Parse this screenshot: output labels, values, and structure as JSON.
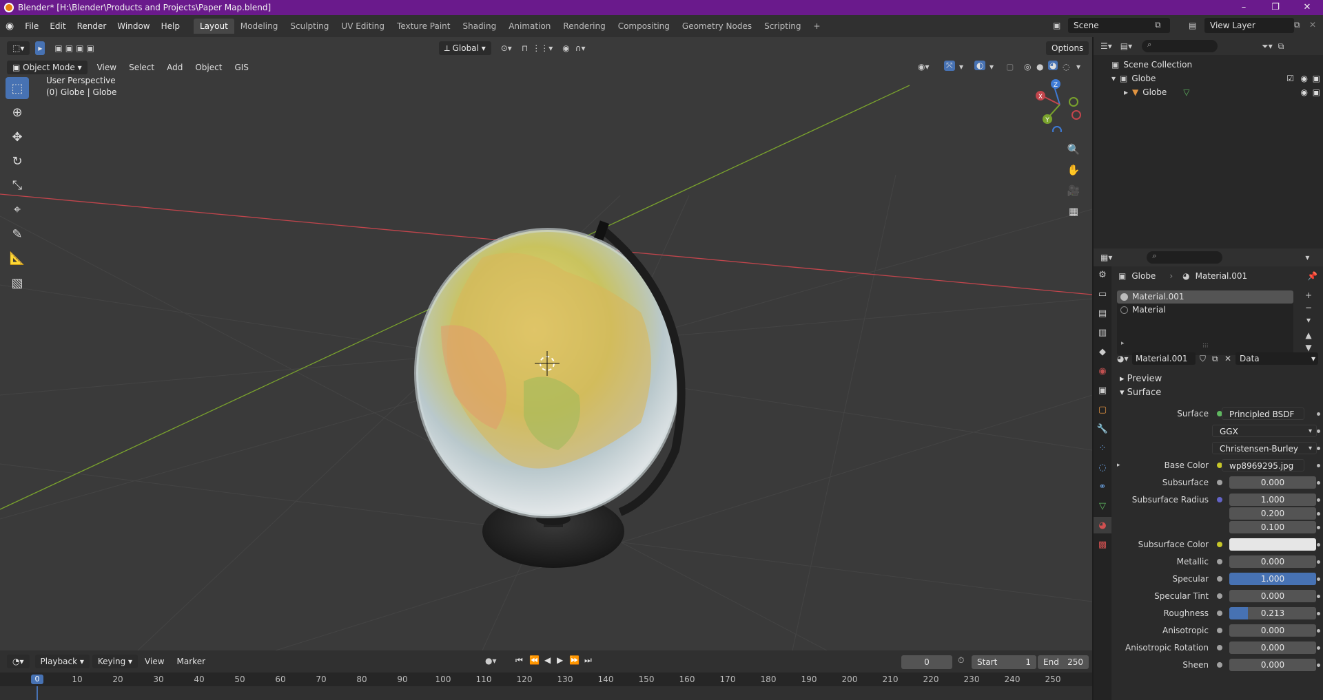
{
  "window": {
    "title": "Blender* [H:\\Blender\\Products and Projects\\Paper Map.blend]",
    "controls": [
      "–",
      "❐",
      "✕"
    ]
  },
  "menu": [
    "File",
    "Edit",
    "Render",
    "Window",
    "Help"
  ],
  "workspaces": [
    "Layout",
    "Modeling",
    "Sculpting",
    "UV Editing",
    "Texture Paint",
    "Shading",
    "Animation",
    "Rendering",
    "Compositing",
    "Geometry Nodes",
    "Scripting",
    "+"
  ],
  "active_workspace": "Layout",
  "scene": {
    "name": "Scene",
    "view_layer": "View Layer"
  },
  "viewport": {
    "transform_orientation": "Global",
    "options_label": "Options",
    "mode": "Object Mode",
    "header_menus": [
      "View",
      "Select",
      "Add",
      "Object",
      "GIS"
    ],
    "overlay_line1": "User Perspective",
    "overlay_line2": "(0) Globe | Globe",
    "axes": {
      "x": "X",
      "y": "Y",
      "z": "Z"
    }
  },
  "tools": [
    "select-box",
    "cursor",
    "move",
    "rotate",
    "scale",
    "transform",
    "annotate",
    "measure",
    "add-cube"
  ],
  "timeline": {
    "menus": [
      "Playback",
      "Keying",
      "View",
      "Marker"
    ],
    "current_frame": "0",
    "start_label": "Start",
    "start": "1",
    "end_label": "End",
    "end": "250",
    "ruler": [
      "0",
      "10",
      "20",
      "30",
      "40",
      "50",
      "60",
      "70",
      "80",
      "90",
      "100",
      "110",
      "120",
      "130",
      "140",
      "150",
      "160",
      "170",
      "180",
      "190",
      "200",
      "210",
      "220",
      "230",
      "240",
      "250"
    ]
  },
  "outliner": {
    "root": "Scene Collection",
    "collection": "Globe",
    "object": "Globe"
  },
  "properties": {
    "object_name": "Globe",
    "material_name": "Material.001",
    "slots": [
      "Material.001",
      "Material"
    ],
    "material_field": "Material.001",
    "link": "Data",
    "sections": {
      "preview": "Preview",
      "surface": "Surface"
    },
    "rows": [
      {
        "label": "Surface",
        "value": "Principled BSDF",
        "kind": "node"
      },
      {
        "label": "",
        "value": "GGX",
        "kind": "dropdown"
      },
      {
        "label": "",
        "value": "Christensen-Burley",
        "kind": "dropdown"
      },
      {
        "label": "Base Color",
        "value": "wp8969295.jpg",
        "kind": "node"
      },
      {
        "label": "Subsurface",
        "value": "0.000",
        "kind": "num"
      },
      {
        "label": "Subsurface Radius",
        "value": "1.000",
        "kind": "num"
      },
      {
        "label": "",
        "value": "0.200",
        "kind": "num"
      },
      {
        "label": "",
        "value": "0.100",
        "kind": "num"
      },
      {
        "label": "Subsurface Color",
        "value": "",
        "kind": "color"
      },
      {
        "label": "Metallic",
        "value": "0.000",
        "kind": "num"
      },
      {
        "label": "Specular",
        "value": "1.000",
        "kind": "blue"
      },
      {
        "label": "Specular Tint",
        "value": "0.000",
        "kind": "num"
      },
      {
        "label": "Roughness",
        "value": "0.213",
        "kind": "partial",
        "fill": 0.213
      },
      {
        "label": "Anisotropic",
        "value": "0.000",
        "kind": "num"
      },
      {
        "label": "Anisotropic Rotation",
        "value": "0.000",
        "kind": "num"
      },
      {
        "label": "Sheen",
        "value": "0.000",
        "kind": "num"
      }
    ]
  },
  "colors": {
    "title_bar": "#6a1a8c",
    "accent": "#4772b3",
    "x_axis": "#c2454c",
    "y_axis": "#7aa32d",
    "z_axis": "#3e7bd6"
  }
}
